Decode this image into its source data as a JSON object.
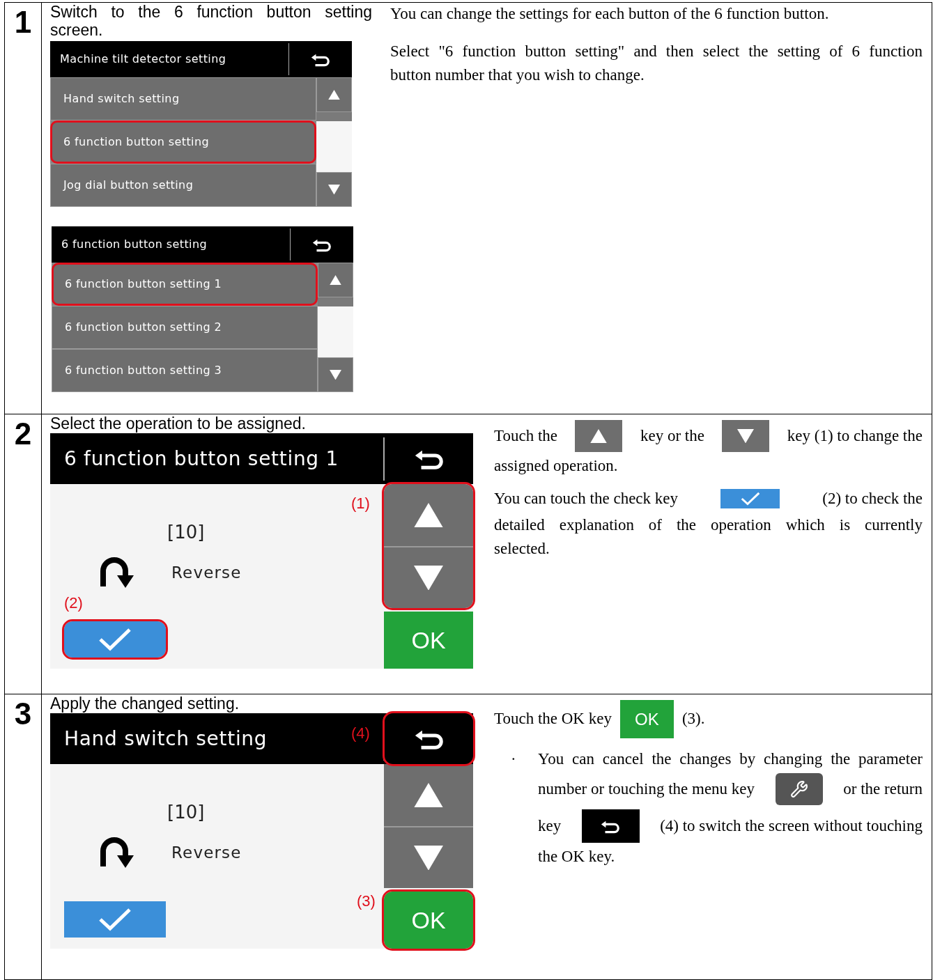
{
  "steps": [
    {
      "number": "1",
      "instruction": "Switch to the 6 function button setting screen.",
      "screens": [
        {
          "kind": "list",
          "title": "Machine tilt detector setting",
          "items": [
            {
              "label": "Hand switch setting",
              "selected": false
            },
            {
              "label": "6 function button setting",
              "selected": true
            },
            {
              "label": "Jog dial button setting",
              "selected": false
            }
          ]
        },
        {
          "kind": "list",
          "title": "6 function button setting",
          "items": [
            {
              "label": "6 function button setting 1",
              "selected": true
            },
            {
              "label": "6 function button setting 2",
              "selected": false
            },
            {
              "label": "6 function button setting 3",
              "selected": false
            }
          ]
        }
      ],
      "notes": [
        {
          "lines": [
            [
              {
                "kind": "text",
                "text": "You can change the settings for each button of the 6 function button."
              }
            ]
          ]
        },
        {
          "lines": [
            [
              {
                "kind": "text",
                "text": "Select \"6 function button setting\" and then select the setting of 6 function"
              }
            ],
            [
              {
                "kind": "text",
                "text": "button number that you wish to change."
              }
            ]
          ]
        }
      ]
    },
    {
      "number": "2",
      "instruction": "Select the operation to be assigned.",
      "screens": [
        {
          "kind": "detail",
          "title": "6 function button setting 1",
          "code": "[10]",
          "operation": "Reverse",
          "ok": "OK",
          "return_highlighted": false,
          "arrows_highlighted": true,
          "check_highlighted": true,
          "ok_highlighted": false,
          "arrows_callout": "(1)",
          "check_callout": "(2)"
        }
      ],
      "notes": [
        {
          "lines": [
            [
              {
                "kind": "text",
                "text": "Touch the"
              },
              {
                "kind": "up_key"
              },
              {
                "kind": "text",
                "text": "key or the"
              },
              {
                "kind": "down_key"
              },
              {
                "kind": "text",
                "text": "key (1) to change the"
              }
            ],
            [
              {
                "kind": "text",
                "text": "assigned operation."
              }
            ]
          ]
        },
        {
          "lines": [
            [
              {
                "kind": "text",
                "text": "You can touch the check key"
              },
              {
                "kind": "check_key"
              },
              {
                "kind": "text",
                "text": "(2) to check the"
              }
            ],
            [
              {
                "kind": "text",
                "text": "detailed explanation of the operation which is currently"
              }
            ],
            [
              {
                "kind": "text",
                "text": "selected."
              }
            ]
          ]
        }
      ]
    },
    {
      "number": "3",
      "instruction": "Apply the changed setting.",
      "screens": [
        {
          "kind": "detail",
          "title": "Hand switch setting",
          "code": "[10]",
          "operation": "Reverse",
          "ok": "OK",
          "return_highlighted": true,
          "arrows_highlighted": false,
          "check_highlighted": false,
          "ok_highlighted": true,
          "return_callout": "(4)",
          "ok_callout": "(3)"
        }
      ],
      "notes": [
        {
          "lines": [
            [
              {
                "kind": "text",
                "text": "Touch the OK key"
              },
              {
                "kind": "ok_key",
                "label": "OK"
              },
              {
                "kind": "text",
                "text": "(3)."
              }
            ]
          ]
        },
        {
          "bullet": "·",
          "lines": [
            [
              {
                "kind": "text",
                "text": "You can cancel the changes by changing the parameter"
              }
            ],
            [
              {
                "kind": "text",
                "text": "number or touching the menu key"
              },
              {
                "kind": "menu_key"
              },
              {
                "kind": "text",
                "text": "or the return"
              }
            ],
            [
              {
                "kind": "text",
                "text": "key"
              },
              {
                "kind": "return_key"
              },
              {
                "kind": "text",
                "text": "(4) to switch the screen without touching"
              }
            ],
            [
              {
                "kind": "text",
                "text": "the OK key."
              }
            ]
          ]
        }
      ]
    }
  ]
}
